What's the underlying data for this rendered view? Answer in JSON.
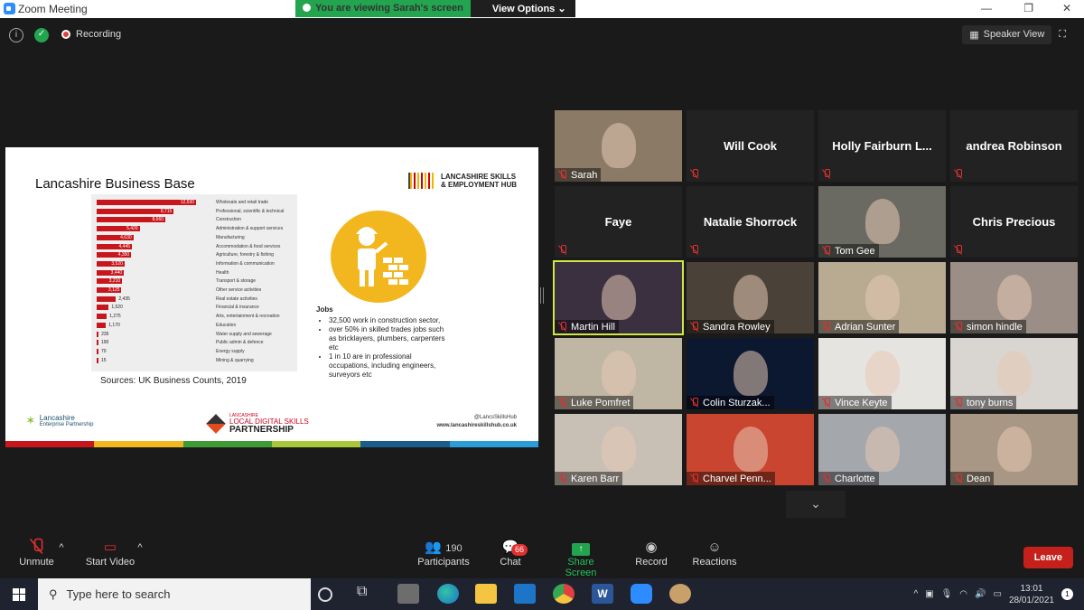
{
  "window": {
    "title": "Zoom Meeting"
  },
  "banner": {
    "viewing": "You are viewing Sarah's screen",
    "options": "View Options"
  },
  "topbar": {
    "recording": "Recording",
    "speaker_view": "Speaker View"
  },
  "slide": {
    "title": "Lancashire Business Base",
    "brand_line1": "LANCASHIRE SKILLS",
    "brand_line2": "& EMPLOYMENT HUB",
    "source": "Sources: UK Business Counts, 2019",
    "jobs_heading": "Jobs",
    "jobs_points": [
      "32,500 work in construction sector,",
      "over 50% in skilled trades jobs such as bricklayers, plumbers, carpenters etc",
      "1 in 10 are in professional occupations, including engineers, surveyors etc"
    ],
    "footer_left_line1": "Lancashire",
    "footer_left_line2": "Enterprise Partnership",
    "footer_center_small": "LANCASHIRE",
    "footer_center_line1": "LOCAL DIGITAL SKILLS",
    "footer_center_line2": "PARTNERSHIP",
    "footer_right_handle": "@LancsSkillsHub",
    "footer_right_url": "www.lancashireskillshub.co.uk",
    "stripe_colors": [
      "#c8161d",
      "#f2b71e",
      "#3f9c35",
      "#a8c83a",
      "#1a5c8c",
      "#2a9cd8"
    ]
  },
  "chart_data": {
    "type": "bar",
    "orientation": "horizontal",
    "categories": [
      "Wholesale and retail trade",
      "Professional, scientific & technical",
      "Construction",
      "Administration & support services",
      "Manufacturing",
      "Accommodation & food services",
      "Agriculture, forestry & fishing",
      "Information & communication",
      "Health",
      "Transport & storage",
      "Other service activities",
      "Real estate activities",
      "Financial & insurance",
      "Arts, entertainment & recreation",
      "Education",
      "Water supply and sewerage",
      "Public admin & defence",
      "Energy supply",
      "Mining & quarrying"
    ],
    "values": [
      12530,
      9715,
      8660,
      5420,
      4630,
      4445,
      4350,
      3520,
      3440,
      3210,
      3125,
      2435,
      1520,
      1275,
      1170,
      235,
      190,
      70,
      15
    ],
    "labels": [
      "12,530",
      "9,715",
      "8,660",
      "5,420",
      "4,630",
      "4,445",
      "4,350",
      "3,520",
      "3,440",
      "3,210",
      "3,125",
      "2,435",
      "1,520",
      "1,275",
      "1,170",
      "235",
      "190",
      "70",
      "15"
    ],
    "color": "#c8161d"
  },
  "participants": [
    {
      "name": "Sarah",
      "video": true,
      "bg": "#8a7a66"
    },
    {
      "name": "Will Cook",
      "video": false
    },
    {
      "name": "Holly  Fairburn  L...",
      "video": false
    },
    {
      "name": "andrea Robinson",
      "video": false
    },
    {
      "name": "Faye",
      "video": false
    },
    {
      "name": "Natalie Shorrock",
      "video": false
    },
    {
      "name": "Tom Gee",
      "video": true,
      "bg": "#6b6a62"
    },
    {
      "name": "Chris Precious",
      "video": false
    },
    {
      "name": "Martin Hill",
      "video": true,
      "bg": "#3a3040",
      "active": true
    },
    {
      "name": "Sandra Rowley",
      "video": true,
      "bg": "#4a4238"
    },
    {
      "name": "Adrian Sunter",
      "video": true,
      "bg": "#b8ab92"
    },
    {
      "name": "simon hindle",
      "video": true,
      "bg": "#9a8e86"
    },
    {
      "name": "Luke Pomfret",
      "video": true,
      "bg": "#bfb7a4"
    },
    {
      "name": "Colin Sturzak...",
      "video": true,
      "bg": "#0c1730"
    },
    {
      "name": "Vince Keyte",
      "video": true,
      "bg": "#e6e4e0"
    },
    {
      "name": "tony burns",
      "video": true,
      "bg": "#d9d6d1"
    },
    {
      "name": "Karen Barr",
      "video": true,
      "bg": "#c9c0b5"
    },
    {
      "name": "Charvel Penn...",
      "video": true,
      "bg": "#c9452f"
    },
    {
      "name": "Charlotte",
      "video": true,
      "bg": "#a4a7ac"
    },
    {
      "name": "Dean",
      "video": true,
      "bg": "#a89784"
    }
  ],
  "toolbar": {
    "unmute": "Unmute",
    "start_video": "Start Video",
    "participants_count": "190",
    "participants": "Participants",
    "chat_badge": "66",
    "chat": "Chat",
    "share_screen": "Share Screen",
    "record": "Record",
    "reactions": "Reactions",
    "leave": "Leave"
  },
  "taskbar": {
    "search_placeholder": "Type here to search",
    "time": "13:01",
    "date": "28/01/2021",
    "notif_count": "1"
  }
}
